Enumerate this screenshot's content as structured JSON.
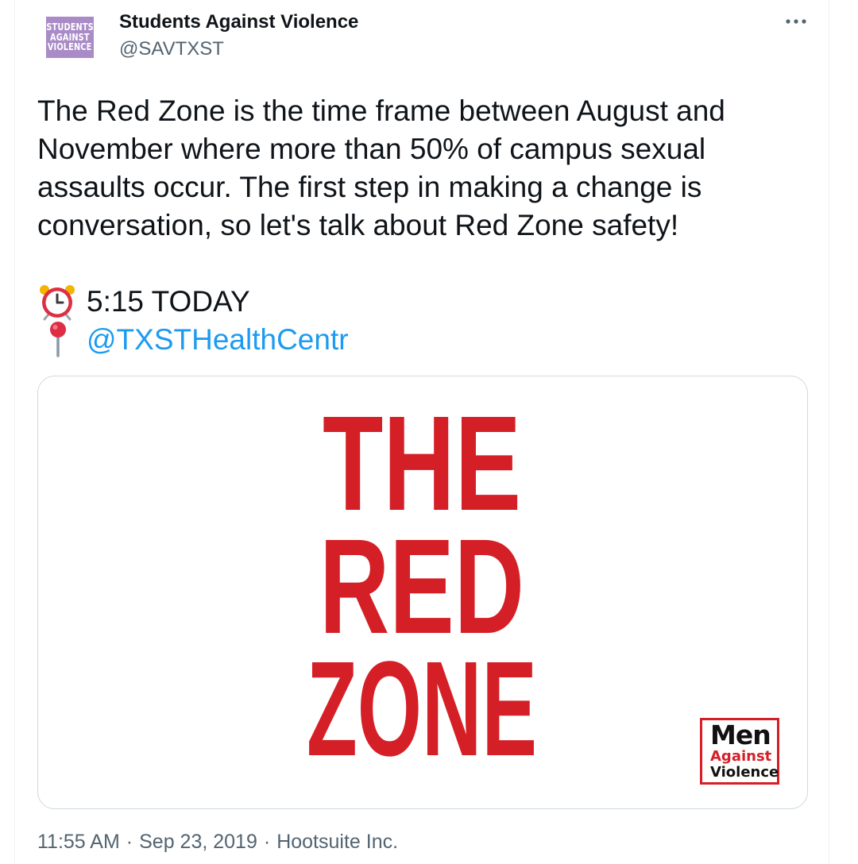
{
  "author": {
    "avatar_text": [
      "STUDENTS",
      "AGAINST",
      "VIOLENCE"
    ],
    "display_name": "Students Against Violence",
    "handle": "@SAVTXST"
  },
  "menu": {
    "icon": "more-horizontal-icon"
  },
  "tweet": {
    "text": "The Red Zone is the time frame between August and November where more than 50% of campus sexual assaults occur. The first step in making a change is conversation, so let's talk about Red Zone safety!",
    "line1_icon": "alarm-clock-icon",
    "line1_text": "5:15 TODAY",
    "line2_icon": "round-pushpin-icon",
    "line2_mention": "@TXSTHealthCentr"
  },
  "media": {
    "title_lines": [
      "THE",
      "RED",
      "ZONE"
    ],
    "badge": {
      "line1": "Men",
      "line2": "Against",
      "line3": "Violence"
    },
    "colors": {
      "red": "#d51f26"
    }
  },
  "meta": {
    "time": "11:55 AM",
    "date": "Sep 23, 2019",
    "source": "Hootsuite Inc.",
    "separator": "·"
  }
}
